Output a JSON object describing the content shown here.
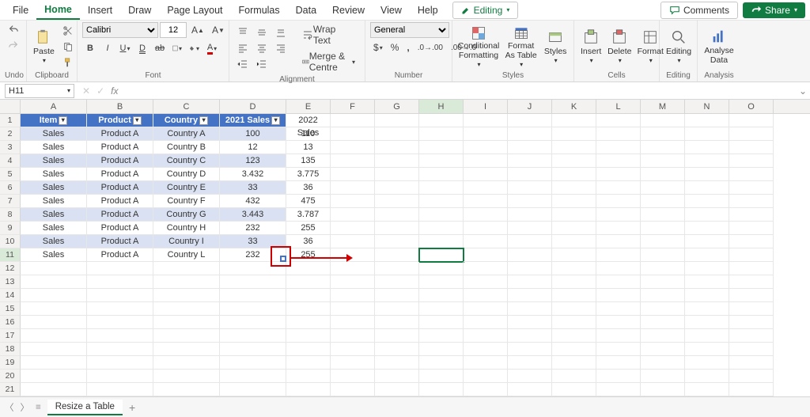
{
  "menu": {
    "items": [
      "File",
      "Home",
      "Insert",
      "Draw",
      "Page Layout",
      "Formulas",
      "Data",
      "Review",
      "View",
      "Help"
    ],
    "activeIndex": 1,
    "editing": "Editing",
    "comments": "Comments",
    "share": "Share"
  },
  "ribbon": {
    "undo": "Undo",
    "clipboard": {
      "label": "Clipboard",
      "paste": "Paste"
    },
    "font": {
      "label": "Font",
      "name": "Calibri",
      "size": "12"
    },
    "alignment": {
      "label": "Alignment",
      "wrap": "Wrap Text",
      "merge": "Merge & Centre"
    },
    "number": {
      "label": "Number",
      "format": "General"
    },
    "styles": {
      "label": "Styles",
      "cond": "Conditional Formatting",
      "fmtTable": "Format As Table",
      "styles": "Styles"
    },
    "cells": {
      "label": "Cells",
      "insert": "Insert",
      "delete": "Delete",
      "format": "Format"
    },
    "editing": {
      "label": "Editing",
      "editing": "Editing"
    },
    "analysis": {
      "label": "Analysis",
      "analyse": "Analyse Data"
    }
  },
  "namebox": "H11",
  "columns": [
    "A",
    "B",
    "C",
    "D",
    "E",
    "F",
    "G",
    "H",
    "I",
    "J",
    "K",
    "L",
    "M",
    "N",
    "O"
  ],
  "wideCols": [
    0,
    1,
    2,
    3
  ],
  "activeCol": 7,
  "activeRow": 11,
  "rowCount": 21,
  "table": {
    "headers": [
      "Item",
      "Product",
      "Country",
      "2021 Sales"
    ],
    "extraHeader": "2022 Sales",
    "rows": [
      [
        "Sales",
        "Product A",
        "Country A",
        "100",
        "110"
      ],
      [
        "Sales",
        "Product A",
        "Country B",
        "12",
        "13"
      ],
      [
        "Sales",
        "Product A",
        "Country C",
        "123",
        "135"
      ],
      [
        "Sales",
        "Product A",
        "Country D",
        "3.432",
        "3.775"
      ],
      [
        "Sales",
        "Product A",
        "Country E",
        "33",
        "36"
      ],
      [
        "Sales",
        "Product A",
        "Country F",
        "432",
        "475"
      ],
      [
        "Sales",
        "Product A",
        "Country G",
        "3.443",
        "3.787"
      ],
      [
        "Sales",
        "Product A",
        "Country H",
        "232",
        "255"
      ],
      [
        "Sales",
        "Product A",
        "Country I",
        "33",
        "36"
      ],
      [
        "Sales",
        "Product A",
        "Country L",
        "232",
        "255"
      ]
    ]
  },
  "sheetTab": "Resize a Table"
}
